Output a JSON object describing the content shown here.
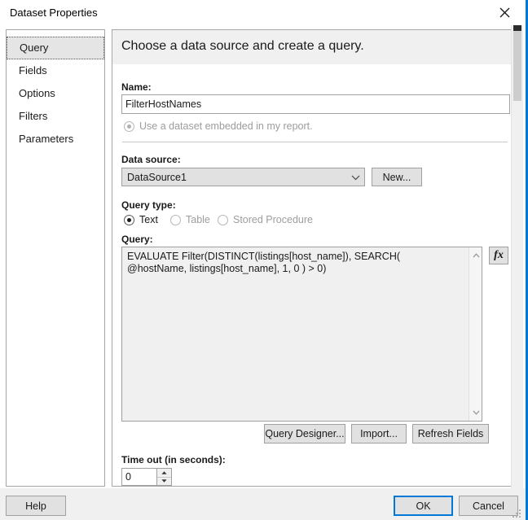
{
  "window": {
    "title": "Dataset Properties",
    "close_icon": "close-icon",
    "accent_color": "#0078d7"
  },
  "sidebar": {
    "items": [
      {
        "label": "Query",
        "selected": true
      },
      {
        "label": "Fields",
        "selected": false
      },
      {
        "label": "Options",
        "selected": false
      },
      {
        "label": "Filters",
        "selected": false
      },
      {
        "label": "Parameters",
        "selected": false
      }
    ]
  },
  "content": {
    "header": "Choose a data source and create a query.",
    "name": {
      "label": "Name:",
      "value": "FilterHostNames"
    },
    "embedded_dataset": {
      "label": "Use a dataset embedded in my report.",
      "checked": true,
      "enabled": false
    },
    "data_source": {
      "label": "Data source:",
      "value": "DataSource1",
      "options": [
        "DataSource1"
      ],
      "arrow_icon": "chevron-down-icon",
      "new_button": "New..."
    },
    "query_type": {
      "label": "Query type:",
      "options": [
        {
          "label": "Text",
          "selected": true,
          "enabled": true
        },
        {
          "label": "Table",
          "selected": false,
          "enabled": false
        },
        {
          "label": "Stored Procedure",
          "selected": false,
          "enabled": false
        }
      ]
    },
    "query": {
      "label": "Query:",
      "value": "EVALUATE Filter(DISTINCT(listings[host_name]), SEARCH( @hostName, listings[host_name], 1, 0 ) > 0)",
      "expression_button": "fx",
      "scroll_up_icon": "chevron-up-icon",
      "scroll_down_icon": "chevron-down-icon"
    },
    "query_actions": {
      "query_designer": "Query Designer...",
      "import": "Import...",
      "refresh_fields": "Refresh Fields"
    },
    "timeout": {
      "label": "Time out (in seconds):",
      "value": "0",
      "up_icon": "spinner-up-icon",
      "down_icon": "spinner-down-icon"
    }
  },
  "footer": {
    "help": "Help",
    "ok": "OK",
    "cancel": "Cancel"
  }
}
